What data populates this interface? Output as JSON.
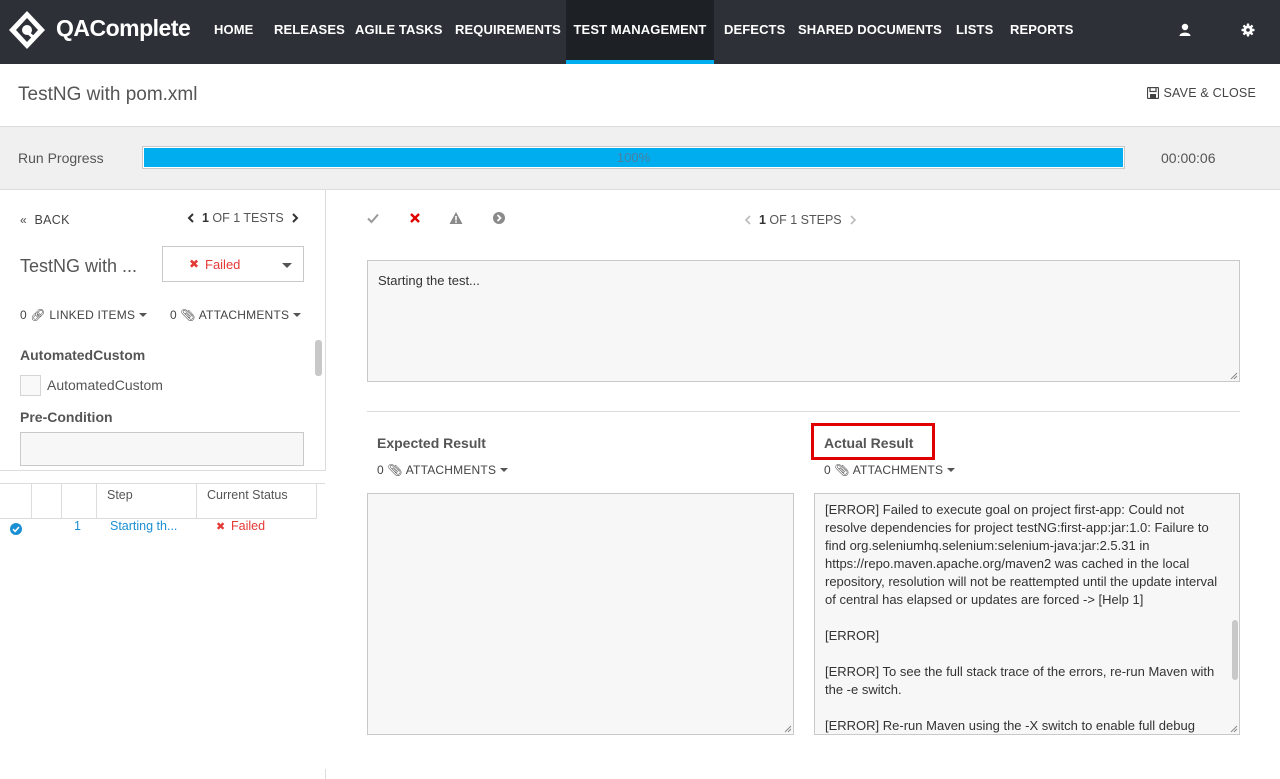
{
  "app": {
    "logo_text": "QAComplete",
    "nav": [
      {
        "label": "HOME"
      },
      {
        "label": "RELEASES"
      },
      {
        "label": "AGILE TASKS"
      },
      {
        "label": "REQUIREMENTS"
      },
      {
        "label": "TEST MANAGEMENT",
        "active": true
      },
      {
        "label": "DEFECTS"
      },
      {
        "label": "SHARED DOCUMENTS"
      },
      {
        "label": "LISTS"
      },
      {
        "label": "REPORTS"
      }
    ],
    "icons": {
      "user": "user-icon",
      "settings": "gear-icon"
    },
    "accent_color": "#00aeef",
    "nav_bg": "#2d3137"
  },
  "header": {
    "title": "TestNG with pom.xml",
    "save_close": "SAVE & CLOSE"
  },
  "run": {
    "label": "Run Progress",
    "progress_percent": 100,
    "progress_text": "100%",
    "elapsed": "00:00:06"
  },
  "left": {
    "back": "BACK",
    "tests_current": "1",
    "tests_rest": "OF 1 TESTS",
    "test_name": "TestNG with ...",
    "status": "Failed",
    "linked_count": "0",
    "linked_label": "LINKED ITEMS",
    "attach_count": "0",
    "attach_label": "ATTACHMENTS",
    "custom_field_title": "AutomatedCustom",
    "custom_checkbox_label": "AutomatedCustom",
    "precondition_label": "Pre-Condition",
    "table": {
      "headers": [
        "Step",
        "Current Status"
      ],
      "rows": [
        {
          "num": "1",
          "step": "Starting th...",
          "status": "Failed"
        }
      ]
    }
  },
  "main": {
    "steps_current": "1",
    "steps_rest": "OF 1 STEPS",
    "description": "Starting the test...",
    "expected_title": "Expected Result",
    "actual_title": "Actual Result",
    "expected_att_count": "0",
    "actual_att_count": "0",
    "att_label": "ATTACHMENTS",
    "actual_lines": [
      "[ERROR] Failed to execute goal on project first-app: Could not resolve dependencies for project testNG:first-app:jar:1.0: Failure to find org.seleniumhq.selenium:selenium-java:jar:2.5.31 in https://repo.maven.apache.org/maven2 was cached in the local repository, resolution will not be reattempted until the update interval of central has elapsed or updates are forced -> [Help 1]",
      "[ERROR]",
      "[ERROR] To see the full stack trace of the errors, re-run Maven with the -e switch.",
      "[ERROR] Re-run Maven using the -X switch to enable full debug"
    ],
    "status_color_failed": "#e53935"
  }
}
